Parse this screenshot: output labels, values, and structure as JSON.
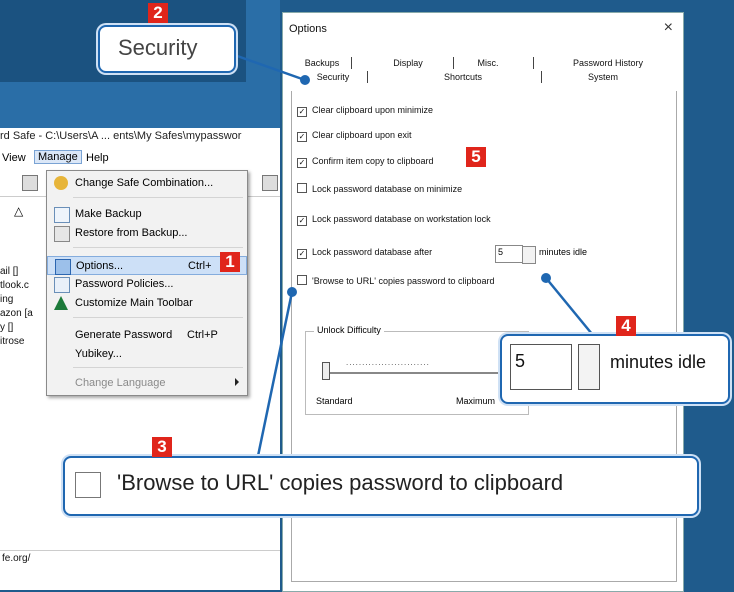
{
  "background_window": {
    "title": "rd Safe - C:\\Users\\A ... ents\\My Safes\\mypasswor",
    "menubar": [
      "View",
      "Manage",
      "Help"
    ],
    "tree_items": [
      "ail []",
      "tlook.c",
      "ing",
      "azon [a",
      "y []",
      "itrose"
    ],
    "status_text": "fe.org/"
  },
  "manage_menu": {
    "items": [
      {
        "label": "Change Safe Combination...",
        "icon": "key-icon"
      },
      {
        "label": "Make Backup",
        "icon": "backup-icon"
      },
      {
        "label": "Restore from Backup...",
        "icon": "restore-icon"
      },
      {
        "label": "Options...",
        "shortcut": "Ctrl+",
        "icon": "options-icon",
        "highlighted": true
      },
      {
        "label": "Password Policies...",
        "icon": "policy-icon"
      },
      {
        "label": "Customize Main Toolbar",
        "icon": "toolbar-icon"
      },
      {
        "label": "Generate Password",
        "shortcut": "Ctrl+P"
      },
      {
        "label": "Yubikey..."
      },
      {
        "label": "Change Language",
        "disabled": true
      }
    ]
  },
  "options_dialog": {
    "title": "Options",
    "close": "×",
    "tabs_row1": [
      "Backups",
      "Display",
      "Misc.",
      "Password History"
    ],
    "tabs_row2": [
      "Security",
      "Shortcuts",
      "System"
    ],
    "options": [
      {
        "label": "Clear clipboard upon minimize",
        "checked": true
      },
      {
        "label": "Clear clipboard upon exit",
        "checked": true
      },
      {
        "label": "Confirm item copy to clipboard",
        "checked": true
      },
      {
        "label": "Lock password database on minimize",
        "checked": false
      },
      {
        "label": "Lock password database on workstation lock",
        "checked": true
      },
      {
        "label": "Lock password database after",
        "checked": true
      },
      {
        "label": "'Browse to URL' copies password to clipboard",
        "checked": false
      }
    ],
    "idle_minutes": "5",
    "idle_suffix": "minutes idle",
    "unlock_group": {
      "title": "Unlock Difficulty",
      "left": "Standard",
      "right": "Maximum"
    }
  },
  "callouts": {
    "security_tab": "Security",
    "idle_value": "5",
    "idle_suffix": "minutes idle",
    "browse_url": "'Browse to URL' copies password to clipboard"
  },
  "badges": [
    "1",
    "2",
    "3",
    "4",
    "5"
  ],
  "colors": {
    "accent": "#1f67b1",
    "badge": "#e0251b",
    "highlight": "#cde0f7"
  }
}
